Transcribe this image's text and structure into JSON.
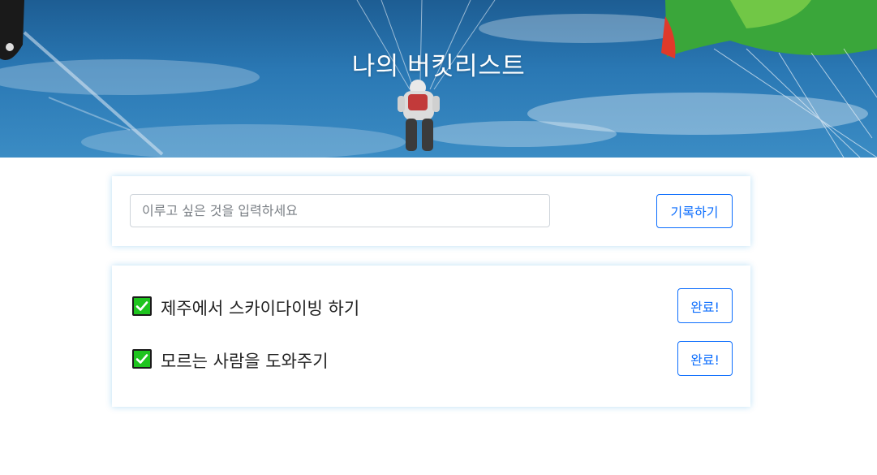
{
  "header": {
    "title": "나의 버킷리스트"
  },
  "form": {
    "input_placeholder": "이루고 싶은 것을 입력하세요",
    "input_value": "",
    "submit_label": "기록하기"
  },
  "bucket_list": {
    "items": [
      {
        "text": "제주에서 스카이다이빙 하기",
        "button_label": "완료!",
        "icon": "checkmark-icon"
      },
      {
        "text": "모르는 사람을 도와주기",
        "button_label": "완료!",
        "icon": "checkmark-icon"
      }
    ]
  },
  "colors": {
    "accent": "#0d6efd",
    "check_green": "#1ec41e",
    "card_glow": "#8cc8ec"
  }
}
